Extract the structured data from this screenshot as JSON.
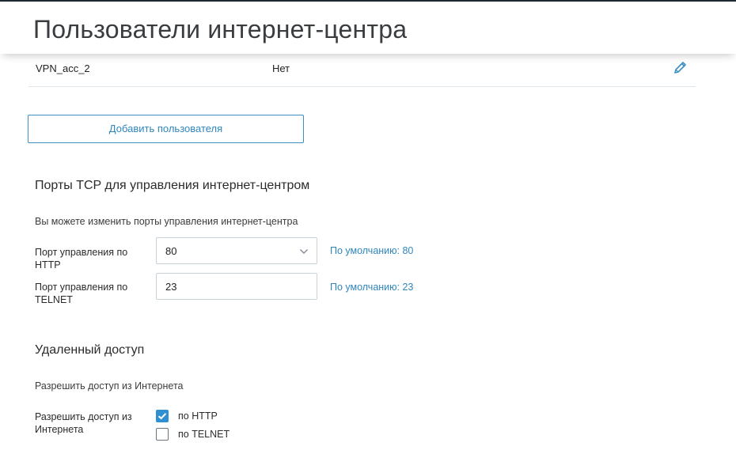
{
  "header": {
    "title": "Пользователи интернет-центра"
  },
  "users": [
    {
      "name": "VPN_acc_2",
      "vpn": "Нет",
      "edit_icon": "pencil-icon"
    }
  ],
  "add_user_button": "Добавить пользователя",
  "tcp_section": {
    "title": "Порты TCP для управления интернет-центром",
    "hint": "Вы можете изменить порты управления интернет-центра",
    "http": {
      "label_line1": "Порт управления по",
      "label_line2": "HTTP",
      "value": "80",
      "default_note": "По умолчанию: 80",
      "icon": "chevron-down-icon"
    },
    "telnet": {
      "label_line1": "Порт управления по",
      "label_line2": "TELNET",
      "value": "23",
      "default_note": "По умолчанию: 23"
    }
  },
  "remote_section": {
    "title": "Удаленный доступ",
    "hint": "Разрешить доступ из Интернета",
    "label_line1": "Разрешить доступ из",
    "label_line2": "Интернета",
    "options": [
      {
        "label": "по HTTP",
        "checked": true
      },
      {
        "label": "по TELNET",
        "checked": false
      }
    ]
  },
  "colors": {
    "accent": "#2f86bc",
    "checkbox_checked": "#2f8fd0",
    "title": "#3a3d40"
  }
}
